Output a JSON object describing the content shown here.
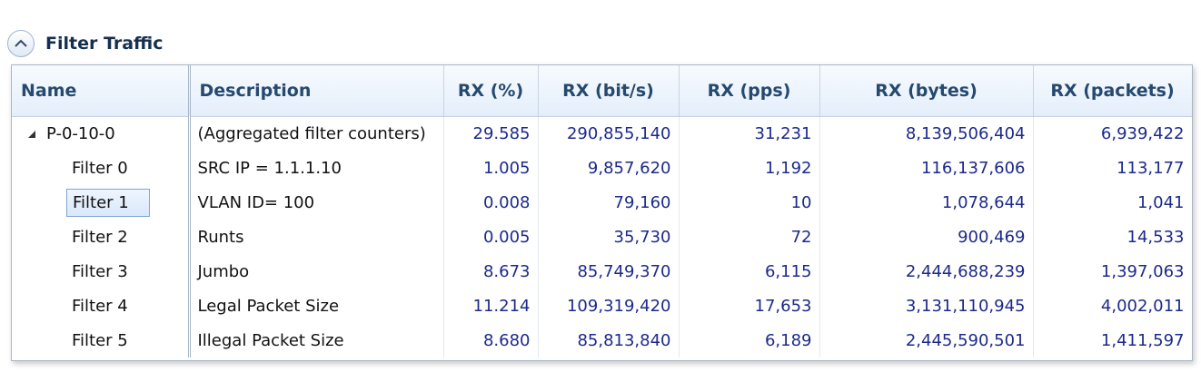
{
  "panel": {
    "title": "Filter Traffic",
    "toggle_icon": "chevron-up-icon"
  },
  "table": {
    "columns": [
      "Name",
      "Description",
      "RX (%)",
      "RX (bit/s)",
      "RX (pps)",
      "RX (bytes)",
      "RX (packets)"
    ],
    "rows": [
      {
        "name": "P-0-10-0",
        "description": "(Aggregated filter counters)",
        "rx_pct": "29.585",
        "rx_bits": "290,855,140",
        "rx_pps": "31,231",
        "rx_bytes": "8,139,506,404",
        "rx_packets": "6,939,422"
      },
      {
        "name": "Filter 0",
        "description": "SRC IP = 1.1.1.10",
        "rx_pct": "1.005",
        "rx_bits": "9,857,620",
        "rx_pps": "1,192",
        "rx_bytes": "116,137,606",
        "rx_packets": "113,177"
      },
      {
        "name": "Filter 1",
        "description": "VLAN ID= 100",
        "rx_pct": "0.008",
        "rx_bits": "79,160",
        "rx_pps": "10",
        "rx_bytes": "1,078,644",
        "rx_packets": "1,041"
      },
      {
        "name": "Filter 2",
        "description": "Runts",
        "rx_pct": "0.005",
        "rx_bits": "35,730",
        "rx_pps": "72",
        "rx_bytes": "900,469",
        "rx_packets": "14,533"
      },
      {
        "name": "Filter 3",
        "description": "Jumbo",
        "rx_pct": "8.673",
        "rx_bits": "85,749,370",
        "rx_pps": "6,115",
        "rx_bytes": "2,444,688,239",
        "rx_packets": "1,397,063"
      },
      {
        "name": "Filter 4",
        "description": "Legal Packet Size",
        "rx_pct": "11.214",
        "rx_bits": "109,319,420",
        "rx_pps": "17,653",
        "rx_bytes": "3,131,110,945",
        "rx_packets": "4,002,011"
      },
      {
        "name": "Filter 5",
        "description": "Illegal Packet Size",
        "rx_pct": "8.680",
        "rx_bits": "85,813,840",
        "rx_pps": "6,189",
        "rx_bytes": "2,445,590,501",
        "rx_packets": "1,411,597"
      }
    ]
  },
  "colors": {
    "header_text": "#26496f",
    "value_text": "#1c2a8a",
    "selection_border": "#7ea6d6"
  }
}
